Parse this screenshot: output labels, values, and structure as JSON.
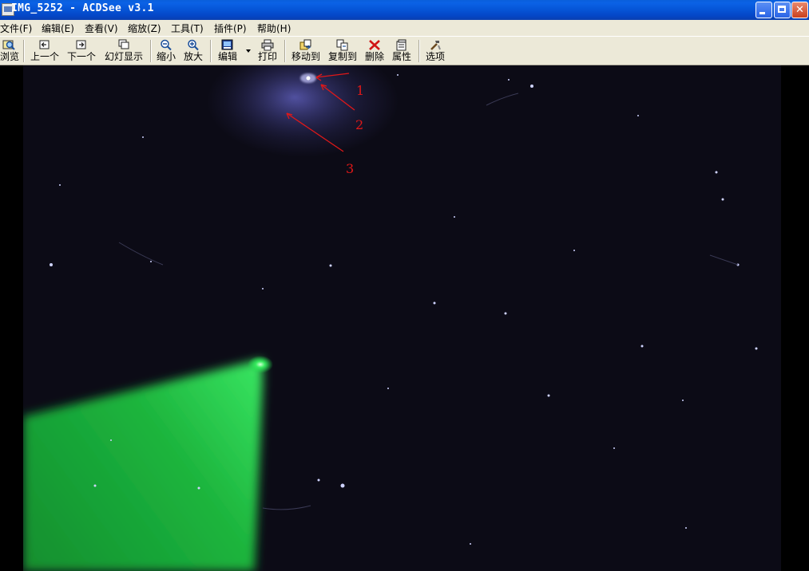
{
  "window": {
    "title": "IMG_5252 - ACDSee v3.1",
    "controls": {
      "minimize": "minimize-button",
      "maximize": "restore-button",
      "close": "close-button"
    }
  },
  "menu": {
    "items": [
      {
        "label": "文件(F)"
      },
      {
        "label": "编辑(E)"
      },
      {
        "label": "查看(V)"
      },
      {
        "label": "缩放(Z)"
      },
      {
        "label": "工具(T)"
      },
      {
        "label": "插件(P)"
      },
      {
        "label": "帮助(H)"
      }
    ]
  },
  "toolbar": {
    "browse": {
      "label": "浏览",
      "icon": "browse-icon"
    },
    "prev": {
      "label": "上一个",
      "icon": "prev-icon"
    },
    "next": {
      "label": "下一个",
      "icon": "next-icon"
    },
    "slideshow": {
      "label": "幻灯显示",
      "icon": "slideshow-icon"
    },
    "zoom_out": {
      "label": "缩小",
      "icon": "zoom-out-icon"
    },
    "zoom_in": {
      "label": "放大",
      "icon": "zoom-in-icon"
    },
    "edit": {
      "label": "编辑",
      "icon": "edit-icon"
    },
    "print": {
      "label": "打印",
      "icon": "print-icon"
    },
    "move_to": {
      "label": "移动到",
      "icon": "move-to-icon"
    },
    "copy_to": {
      "label": "复制到",
      "icon": "copy-to-icon"
    },
    "delete": {
      "label": "删除",
      "icon": "delete-icon"
    },
    "properties": {
      "label": "属性",
      "icon": "properties-icon"
    },
    "options": {
      "label": "选项",
      "icon": "options-icon"
    }
  },
  "image": {
    "annotations": [
      {
        "label": "1"
      },
      {
        "label": "2"
      },
      {
        "label": "3"
      }
    ],
    "colors": {
      "annotation": "#e01818",
      "beam": "#1fe04a",
      "sky": "#0c0b16"
    }
  }
}
